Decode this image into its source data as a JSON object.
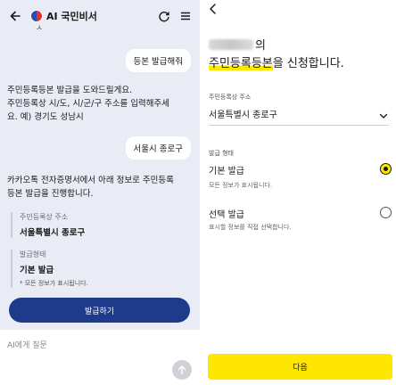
{
  "chat": {
    "header": {
      "title": "AI 국민비서",
      "icons": [
        "back-arrow-icon",
        "refresh-icon",
        "menu-icon"
      ]
    },
    "cut_off_text": "ㅅ",
    "messages": [
      {
        "role": "user",
        "text": "등본 발급해줘"
      },
      {
        "role": "bot",
        "lines": [
          "주민등록등본 발급을 도와드릴게요.",
          "주민등록상 시/도, 시/군/구 주소를 입력해주세",
          "요. 예) 경기도 성남시"
        ]
      },
      {
        "role": "user",
        "text": "서울시 종로구"
      },
      {
        "role": "bot",
        "lines": [
          "카카오톡 전자증명서에서 아래 정보로 주민등록",
          "등본 발급을 진행합니다."
        ]
      }
    ],
    "summary": {
      "address_label": "주민등록상 주소",
      "address_value": "서울특별시 종로구",
      "type_label": "발급형태",
      "type_value": "기본 발급",
      "type_note": "* 모든 정보가 표시됩니다."
    },
    "apply_button": "발급하기",
    "input_placeholder": "AI에게 질문"
  },
  "form": {
    "title_suffix": "의",
    "title_highlight": "주민등록등본",
    "title_rest": "을 신청합니다.",
    "address_label": "주민등록상 주소",
    "address_value": "서울특별시 종로구",
    "type_label": "발급 형태",
    "options": [
      {
        "title": "기본 발급",
        "subtitle": "모든 정보가 표시됩니다.",
        "selected": true
      },
      {
        "title": "선택 발급",
        "subtitle": "표시할 정보를 직접 선택합니다.",
        "selected": false
      }
    ],
    "next_button": "다음"
  },
  "colors": {
    "chat_bg": "#e9ebf5",
    "primary_navy": "#1e3a8a",
    "kakao_yellow": "#ffe600",
    "highlight": "#ffe800"
  }
}
